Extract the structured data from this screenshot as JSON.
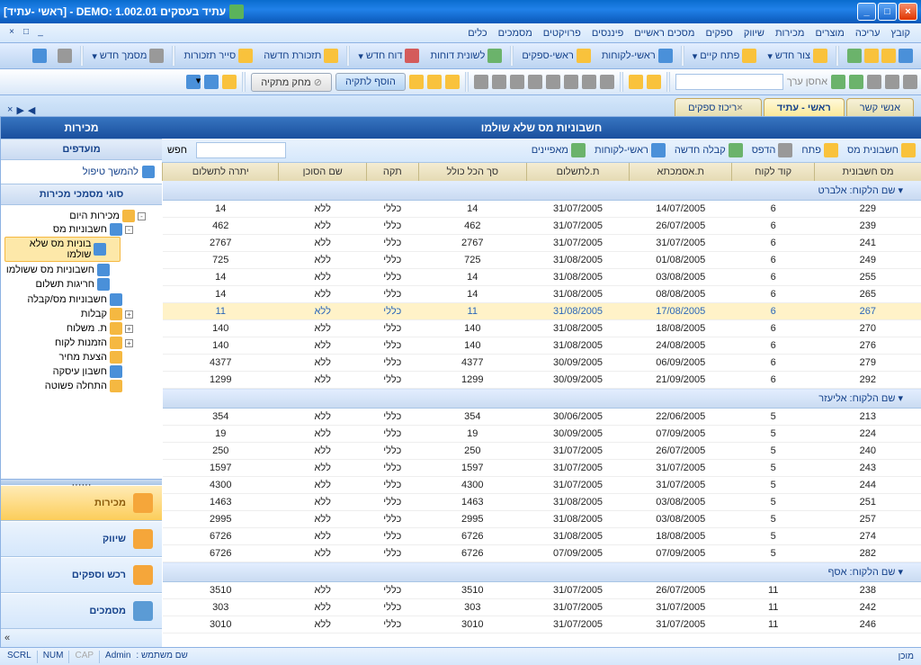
{
  "title": "עתיד בעסקים DEMO: 1.002.01 - [ראשי -עתיד]",
  "menu": [
    "קובץ",
    "עריכה",
    "מוצרים",
    "מכירות",
    "שיווק",
    "ספקים",
    "מסכים ראשיים",
    "פיננסים",
    "פרויקטים",
    "מסמכים",
    "כלים"
  ],
  "toolbar1": {
    "b1": "צור חדש",
    "b2": "פתח קיים",
    "b3": "ראשי-לקוחות",
    "b4": "ראשי-ספקים",
    "b5": "לשונית דוחות",
    "b6": "דוח חדש",
    "b7": "תזכורת חדשה",
    "b8": "סייר תזכורות",
    "b9": "מסמך חדש"
  },
  "toolbar2": {
    "refresh": "אחסן ערך",
    "add": "הוסף לתקיה",
    "del": "מחק מתקיה"
  },
  "tabs": {
    "t1": "אנשי קשר",
    "t2": "ראשי - עתיד",
    "t3": "ריכוז ספקים"
  },
  "side": {
    "title": "מכירות",
    "fav_head": "מועדפים",
    "fav1": "להמשך טיפול",
    "docs_head": "סוגי מסמכי מכירות",
    "tree": {
      "root": "מכירות היום",
      "n1": "חשבוניות מס",
      "n1a": "בוניות מס שלא שולמו",
      "n1b": "חשבוניות מס ששולמו",
      "n1c": "חריגות תשלום",
      "n2": "חשבוניות מס/קבלה",
      "n3": "קבלות",
      "n4": "ת. משלוח",
      "n5": "הזמנות לקוח",
      "n6": "הצעת מחיר",
      "n7": "חשבון עיסקה",
      "n8": "התחלה פשוטה"
    },
    "nav": {
      "a": "מכירות",
      "b": "שיווק",
      "c": "רכש וספקים",
      "d": "מסמכים"
    }
  },
  "main": {
    "title": "חשבוניות מס שלא שולמו",
    "tool1": "חשבונית מס",
    "tool2": "פתח",
    "tool3": "הדפס",
    "tool4": "קבלה חדשה",
    "tool5": "ראשי-לקוחות",
    "tool6": "מאפיינים",
    "search_label": "חפש"
  },
  "cols": [
    "מס חשבונית",
    "קוד לקוח",
    "ת.אסמכתא",
    "ת.לתשלום",
    "סך הכל כולל",
    "תקה",
    "שם הסוכן",
    "יתרה לתשלום"
  ],
  "groups": [
    {
      "label": "שם הלקוח: אלברט",
      "rows": [
        [
          "229",
          "6",
          "14/07/2005",
          "31/07/2005",
          "14",
          "כללי",
          "ללא",
          "14"
        ],
        [
          "239",
          "6",
          "26/07/2005",
          "31/07/2005",
          "462",
          "כללי",
          "ללא",
          "462"
        ],
        [
          "241",
          "6",
          "31/07/2005",
          "31/07/2005",
          "2767",
          "כללי",
          "ללא",
          "2767"
        ],
        [
          "249",
          "6",
          "01/08/2005",
          "31/08/2005",
          "725",
          "כללי",
          "ללא",
          "725"
        ],
        [
          "255",
          "6",
          "03/08/2005",
          "31/08/2005",
          "14",
          "כללי",
          "ללא",
          "14"
        ],
        [
          "265",
          "6",
          "08/08/2005",
          "31/08/2005",
          "14",
          "כללי",
          "ללא",
          "14"
        ],
        [
          "267",
          "6",
          "17/08/2005",
          "31/08/2005",
          "11",
          "כללי",
          "ללא",
          "11"
        ],
        [
          "270",
          "6",
          "18/08/2005",
          "31/08/2005",
          "140",
          "כללי",
          "ללא",
          "140"
        ],
        [
          "276",
          "6",
          "24/08/2005",
          "31/08/2005",
          "140",
          "כללי",
          "ללא",
          "140"
        ],
        [
          "279",
          "6",
          "06/09/2005",
          "30/09/2005",
          "4377",
          "כללי",
          "ללא",
          "4377"
        ],
        [
          "292",
          "6",
          "21/09/2005",
          "30/09/2005",
          "1299",
          "כללי",
          "ללא",
          "1299"
        ]
      ],
      "sel": 6
    },
    {
      "label": "שם הלקוח: אליעזר",
      "rows": [
        [
          "213",
          "5",
          "22/06/2005",
          "30/06/2005",
          "354",
          "כללי",
          "ללא",
          "354"
        ],
        [
          "224",
          "5",
          "07/09/2005",
          "30/09/2005",
          "19",
          "כללי",
          "ללא",
          "19"
        ],
        [
          "240",
          "5",
          "26/07/2005",
          "31/07/2005",
          "250",
          "כללי",
          "ללא",
          "250"
        ],
        [
          "243",
          "5",
          "31/07/2005",
          "31/07/2005",
          "1597",
          "כללי",
          "ללא",
          "1597"
        ],
        [
          "244",
          "5",
          "31/07/2005",
          "31/07/2005",
          "4300",
          "כללי",
          "ללא",
          "4300"
        ],
        [
          "251",
          "5",
          "03/08/2005",
          "31/08/2005",
          "1463",
          "כללי",
          "ללא",
          "1463"
        ],
        [
          "257",
          "5",
          "03/08/2005",
          "31/08/2005",
          "2995",
          "כללי",
          "ללא",
          "2995"
        ],
        [
          "274",
          "5",
          "18/08/2005",
          "31/08/2005",
          "6726",
          "כללי",
          "ללא",
          "6726"
        ],
        [
          "282",
          "5",
          "07/09/2005",
          "07/09/2005",
          "6726",
          "כללי",
          "ללא",
          "6726"
        ]
      ]
    },
    {
      "label": "שם הלקוח: אסף",
      "rows": [
        [
          "238",
          "11",
          "26/07/2005",
          "31/07/2005",
          "3510",
          "כללי",
          "ללא",
          "3510"
        ],
        [
          "242",
          "11",
          "31/07/2005",
          "31/07/2005",
          "303",
          "כללי",
          "ללא",
          "303"
        ],
        [
          "246",
          "11",
          "31/07/2005",
          "31/07/2005",
          "3010",
          "כללי",
          "ללא",
          "3010"
        ]
      ]
    }
  ],
  "status": {
    "ready": "מוכן",
    "user_label": "שם משתמש :",
    "user": "Admin",
    "cap": "CAP",
    "num": "NUM",
    "scrl": "SCRL"
  }
}
